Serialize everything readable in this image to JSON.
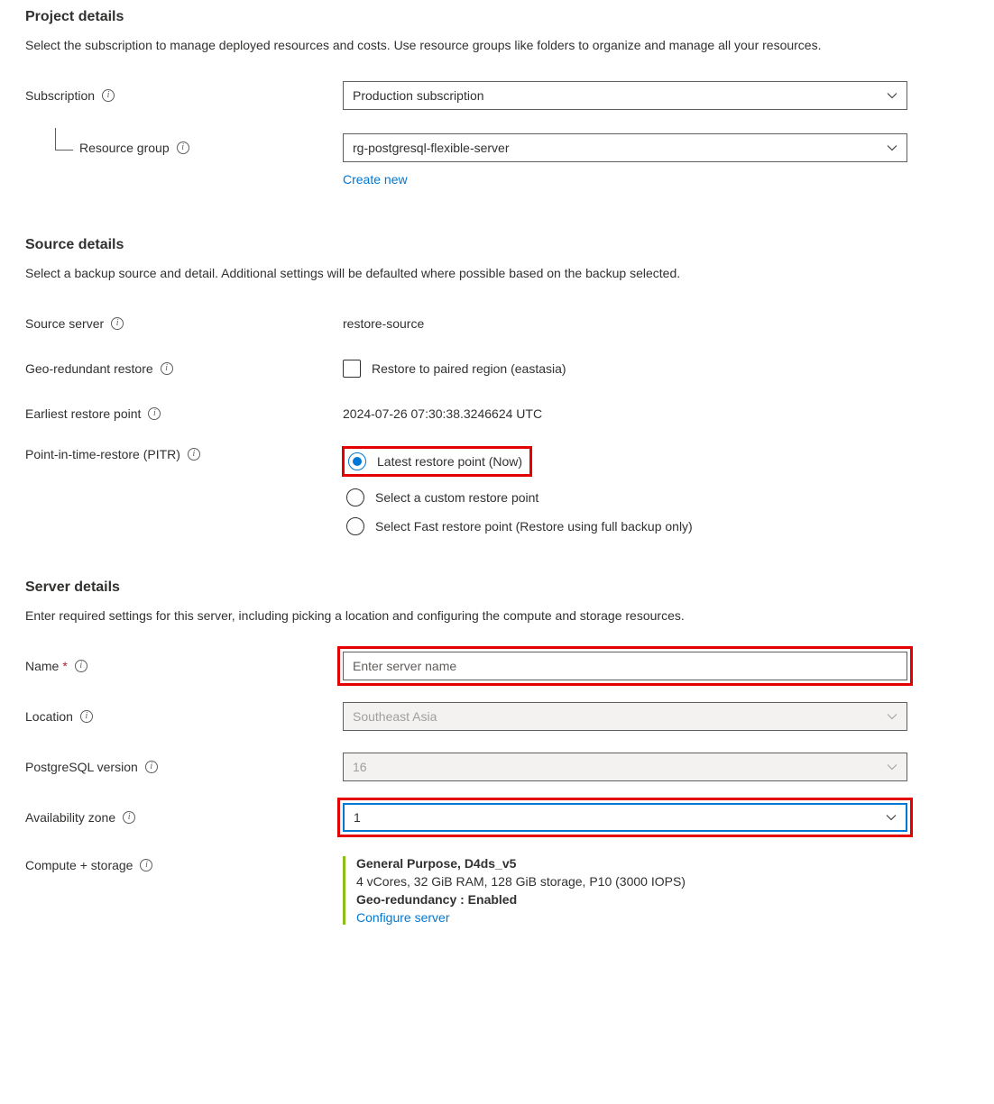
{
  "project": {
    "heading": "Project details",
    "desc": "Select the subscription to manage deployed resources and costs. Use resource groups like folders to organize and manage all your resources.",
    "subscription_label": "Subscription",
    "subscription_value": "Production subscription",
    "resource_group_label": "Resource group",
    "resource_group_value": "rg-postgresql-flexible-server",
    "create_new_link": "Create new"
  },
  "source": {
    "heading": "Source details",
    "desc": "Select a backup source and detail. Additional settings will be defaulted where possible based on the backup selected.",
    "source_server_label": "Source server",
    "source_server_value": "restore-source",
    "geo_redundant_label": "Geo-redundant restore",
    "geo_redundant_checkbox_label": "Restore to paired region (eastasia)",
    "earliest_label": "Earliest restore point",
    "earliest_value": "2024-07-26 07:30:38.3246624 UTC",
    "pitr_label": "Point-in-time-restore (PITR)",
    "pitr_options": [
      "Latest restore point (Now)",
      "Select a custom restore point",
      "Select Fast restore point (Restore using full backup only)"
    ],
    "pitr_selected_index": 0
  },
  "server": {
    "heading": "Server details",
    "desc": "Enter required settings for this server, including picking a location and configuring the compute and storage resources.",
    "name_label": "Name",
    "name_placeholder": "Enter server name",
    "name_value": "",
    "location_label": "Location",
    "location_value": "Southeast Asia",
    "version_label": "PostgreSQL version",
    "version_value": "16",
    "az_label": "Availability zone",
    "az_value": "1",
    "compute_label": "Compute + storage",
    "compute_tier": "General Purpose, D4ds_v5",
    "compute_spec": "4 vCores, 32 GiB RAM, 128 GiB storage, P10 (3000 IOPS)",
    "compute_geo": "Geo-redundancy : Enabled",
    "compute_link": "Configure server"
  }
}
